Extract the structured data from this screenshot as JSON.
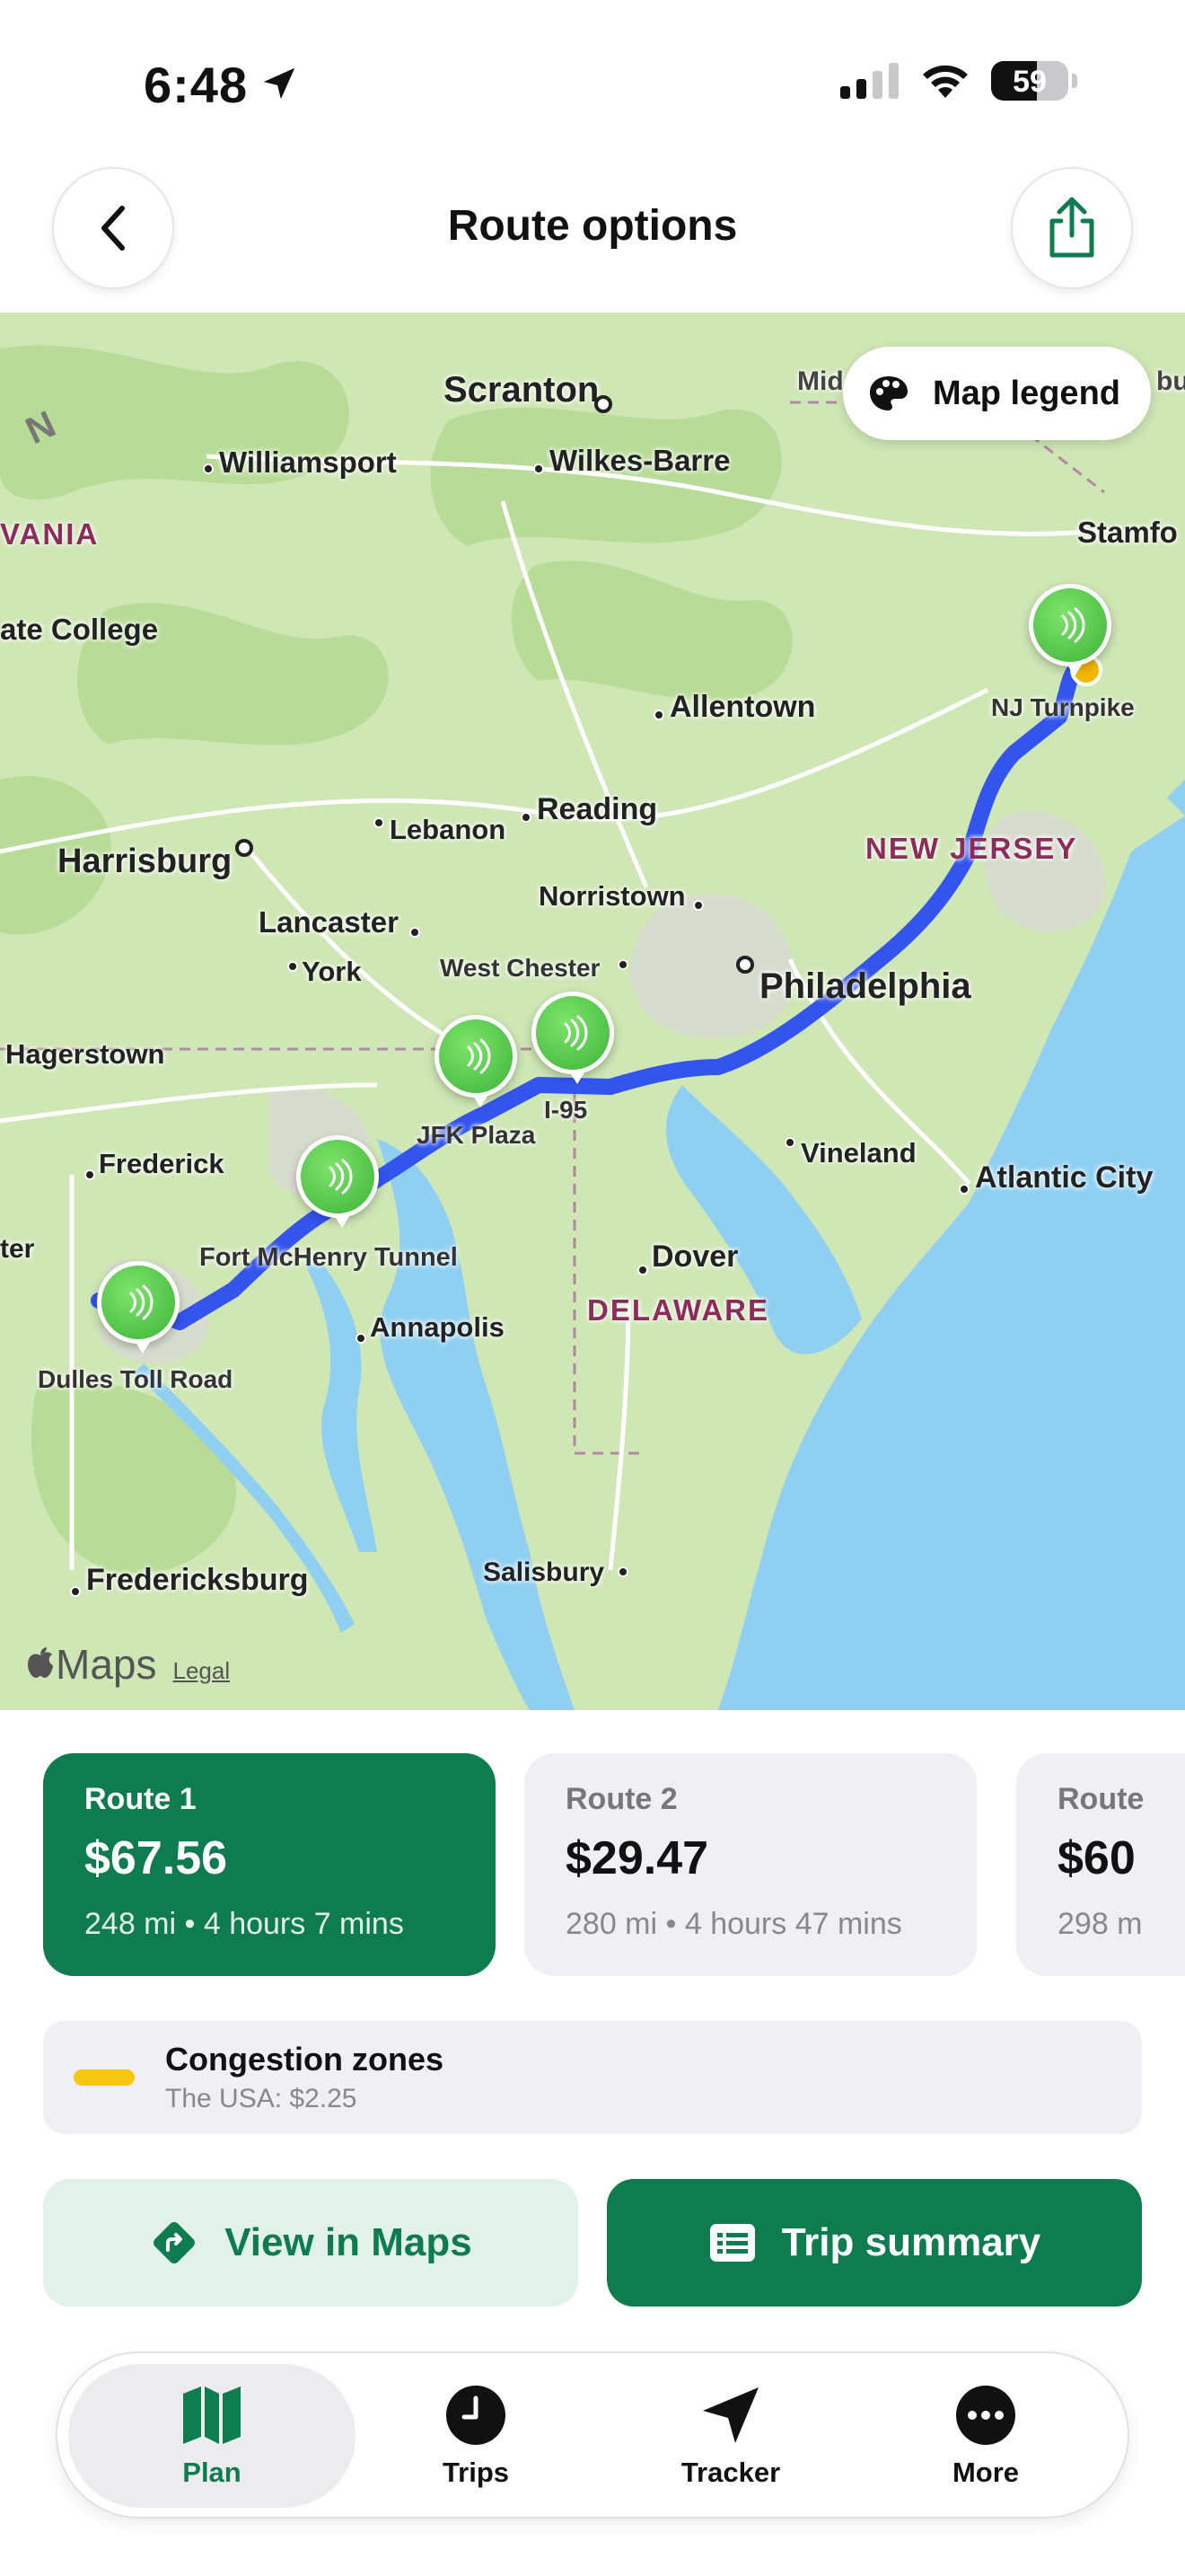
{
  "status_bar": {
    "time": "6:48",
    "battery": "59",
    "battery_level": 0.59
  },
  "header": {
    "title": "Route options"
  },
  "map": {
    "legend_button": "Map legend",
    "attribution": "Maps",
    "legal": "Legal",
    "compass": "N",
    "labels": {
      "scranton": "Scranton",
      "williamsport": "Williamsport",
      "wilkes_barre": "Wilkes-Barre",
      "vania": "VANIA",
      "state_college": "ate College",
      "stamford": "Stamfo",
      "mid": "Mid",
      "bu": "bu",
      "allentown": "Allentown",
      "nj_turnpike": "NJ Turnpike",
      "reading": "Reading",
      "lebanon": "Lebanon",
      "harrisburg": "Harrisburg",
      "new_jersey": "NEW JERSEY",
      "norristown": "Norristown",
      "lancaster": "Lancaster",
      "york": "York",
      "west_chester": "West Chester",
      "philadelphia": "Philadelphia",
      "hagerstown": "Hagerstown",
      "jfk_plaza": "JFK Plaza",
      "i95": "I-95",
      "frederick": "Frederick",
      "vineland": "Vineland",
      "atlantic_city": "Atlantic City",
      "ter": "ter",
      "fort_mchenry": "Fort McHenry Tunnel",
      "dover": "Dover",
      "annapolis": "Annapolis",
      "delaware": "DELAWARE",
      "dulles": "Dulles Toll Road",
      "fredericksburg": "Fredericksburg",
      "salisbury": "Salisbury"
    }
  },
  "routes": [
    {
      "name": "Route 1",
      "price": "$67.56",
      "meta": "248 mi • 4 hours  7 mins"
    },
    {
      "name": "Route 2",
      "price": "$29.47",
      "meta": "280 mi • 4 hours 47 mins"
    },
    {
      "name": "Route",
      "price": "$60",
      "meta": "298 m"
    }
  ],
  "congestion": {
    "title": "Congestion zones",
    "subtitle": "The USA: $2.25",
    "color": "#f7c611"
  },
  "actions": {
    "view_maps": "View in Maps",
    "trip_summary": "Trip summary"
  },
  "tabs": [
    {
      "label": "Plan",
      "icon": "map-icon"
    },
    {
      "label": "Trips",
      "icon": "clock-icon"
    },
    {
      "label": "Tracker",
      "icon": "location-arrow-icon"
    },
    {
      "label": "More",
      "icon": "ellipsis-icon"
    }
  ],
  "colors": {
    "brand_green": "#0e7c4f",
    "route_blue": "#3355ee"
  }
}
